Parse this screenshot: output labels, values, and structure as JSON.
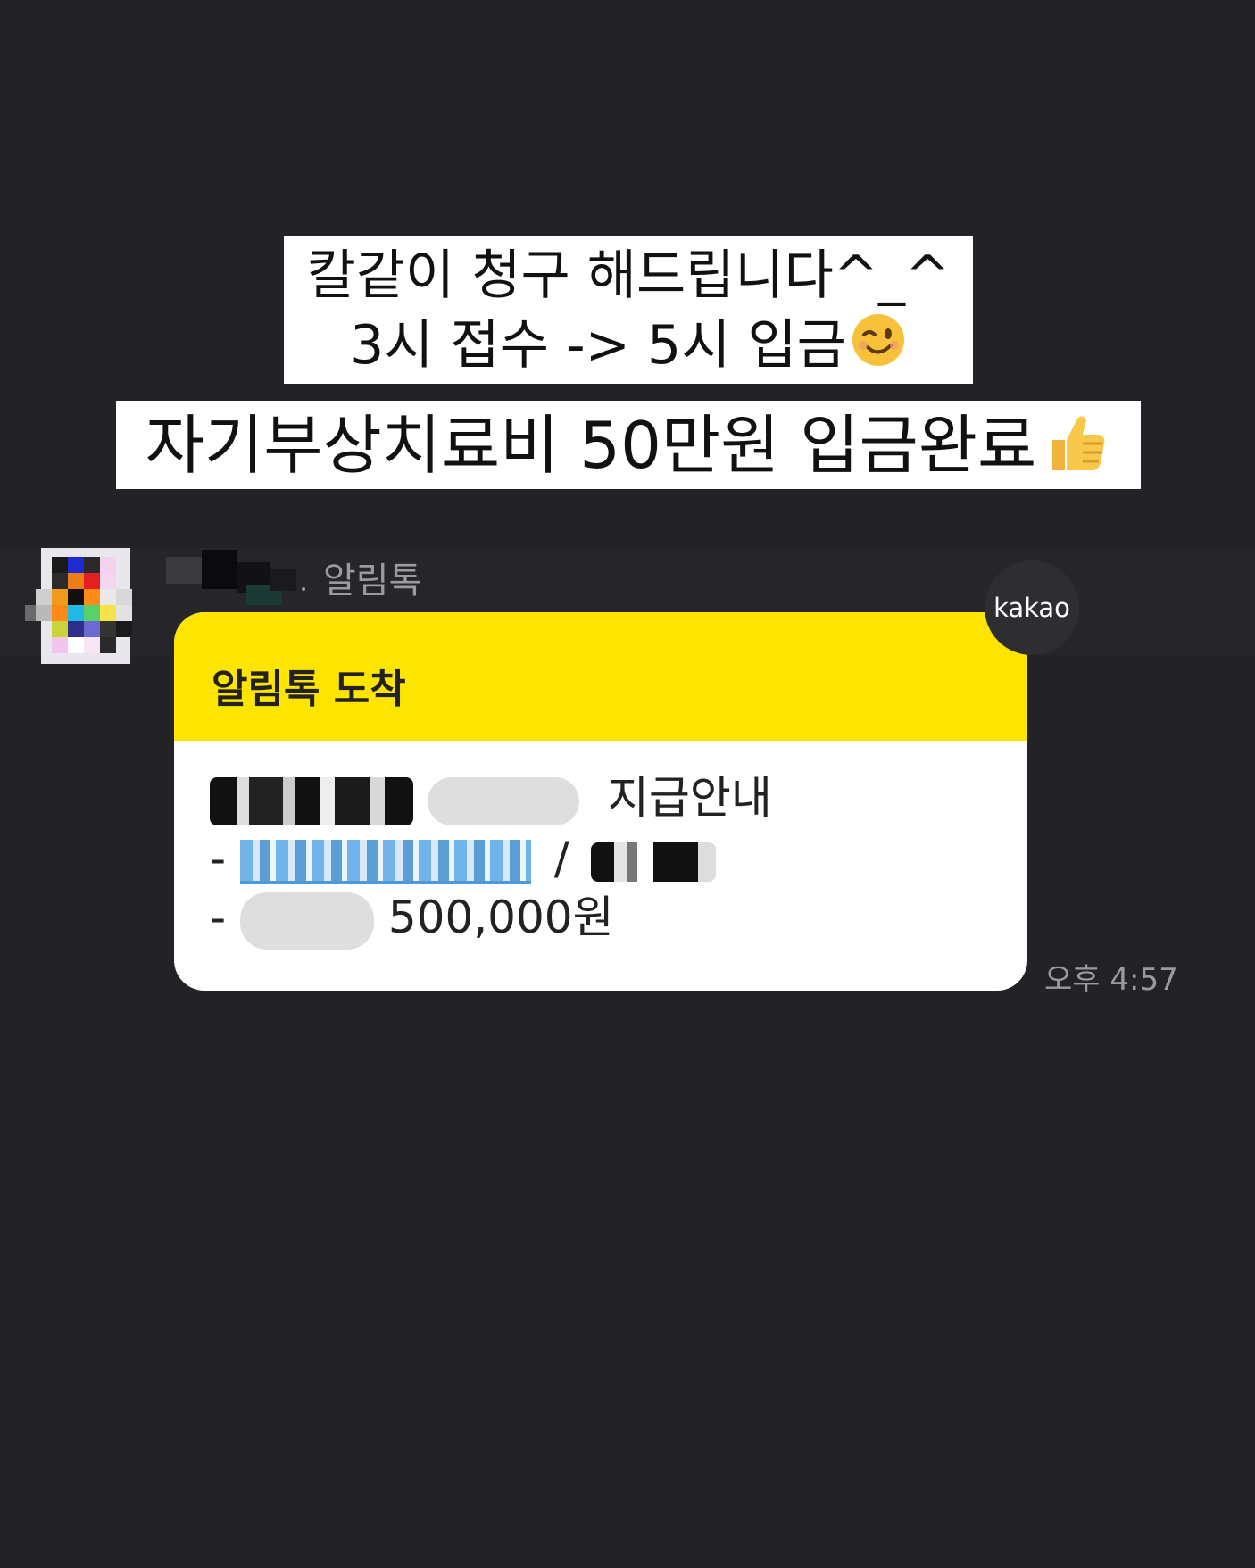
{
  "captions": {
    "line1": "칼같이 청구 해드립니다^_^",
    "line2": "3시 접수 -> 5시 입금",
    "line2_emoji": "winking-face-emoji",
    "line3": "자기부상치료비 50만원 입금완료",
    "line3_emoji": "thumbs-up-emoji"
  },
  "chat": {
    "sender_channel": "알림톡",
    "badge": "kakao",
    "bubble": {
      "title": "알림톡 도착",
      "line1_text": "지급안내",
      "line2_prefix": "- ",
      "line2_separator": "/",
      "line3_prefix": "- ",
      "line3_amount": "500,000원"
    },
    "timestamp": "오후 4:57"
  },
  "colors": {
    "background": "#232327",
    "header_yellow": "#fee500",
    "bubble": "#ffffff",
    "link_blue": "#2a8ad6",
    "muted_text": "#9a9aa0"
  }
}
